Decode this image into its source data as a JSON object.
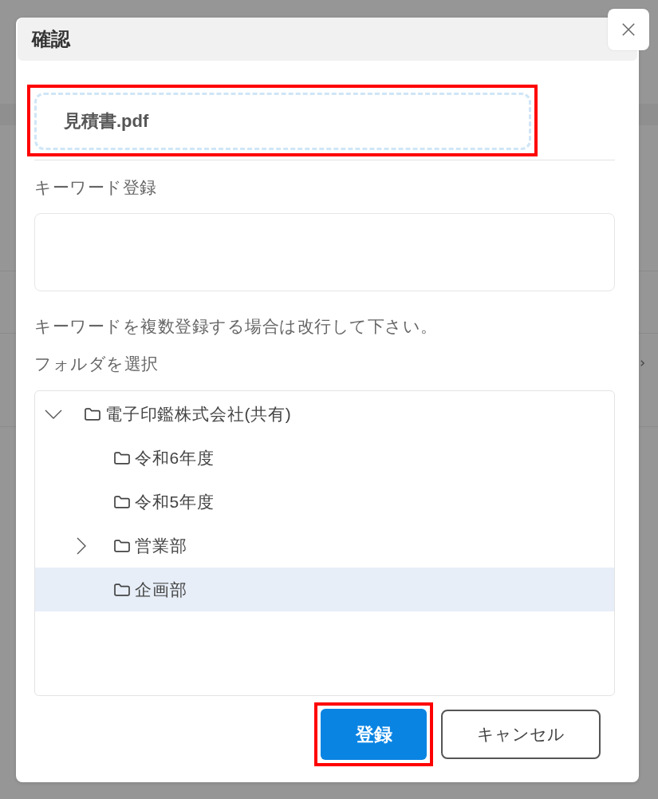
{
  "dialog": {
    "title": "確認"
  },
  "file": {
    "name": "見積書.pdf",
    "highlighted": true
  },
  "keywords": {
    "label": "キーワード登録",
    "hint": "キーワードを複数登録する場合は改行して下さい。"
  },
  "folder_picker": {
    "label": "フォルダを選択",
    "tree": [
      {
        "label": "電子印鑑株式会社(共有)",
        "expanded": true,
        "selected": false,
        "children": [
          {
            "label": "令和6年度",
            "selected": false
          },
          {
            "label": "令和5年度",
            "selected": false
          },
          {
            "label": "営業部",
            "expanded": false,
            "selected": false
          },
          {
            "label": "企画部",
            "selected": true
          }
        ]
      }
    ]
  },
  "buttons": [
    {
      "label": "登録",
      "kind": "primary",
      "highlighted": true
    },
    {
      "label": "キャンセル",
      "kind": "secondary",
      "highlighted": false
    }
  ]
}
